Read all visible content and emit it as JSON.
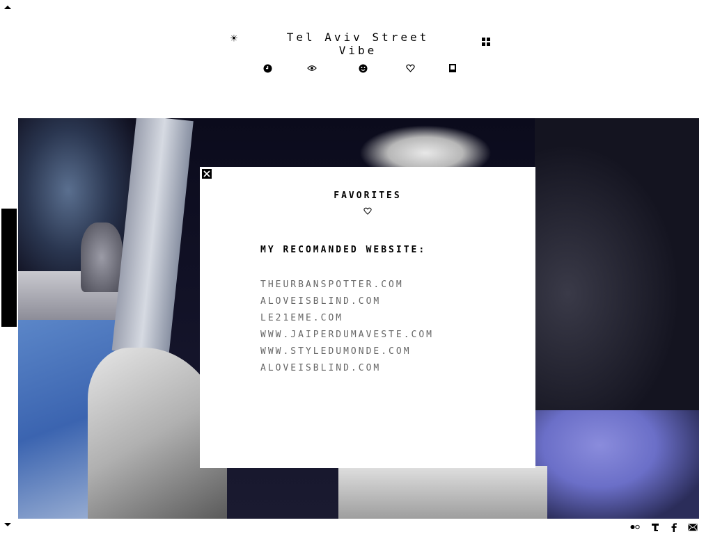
{
  "header": {
    "title": "Tel Aviv Street Vibe",
    "sun_icon": "sun-icon",
    "grid_icon": "grid-icon"
  },
  "nav": [
    {
      "icon": "clock-icon"
    },
    {
      "icon": "eye-icon"
    },
    {
      "icon": "smiley-icon"
    },
    {
      "icon": "heart-icon"
    },
    {
      "icon": "book-icon"
    }
  ],
  "modal": {
    "title": "FAVORITES",
    "heading": "MY RECOMANDED WEBSITE:",
    "links": [
      "THEURBANSPOTTER.COM",
      "ALOVEISBLIND.COM",
      "LE21EME.COM",
      "WWW.JAIPERDUMAVESTE.COM",
      "WWW.STYLEDUMONDE.COM",
      "ALOVEISBLIND.COM"
    ]
  },
  "footer": {
    "social": [
      "flickr-icon",
      "tumblr-icon",
      "facebook-icon",
      "mail-icon"
    ]
  },
  "colors": {
    "background": "#ffffff",
    "text": "#000000",
    "link": "#666666",
    "photo_dark": "#0a0a18"
  }
}
